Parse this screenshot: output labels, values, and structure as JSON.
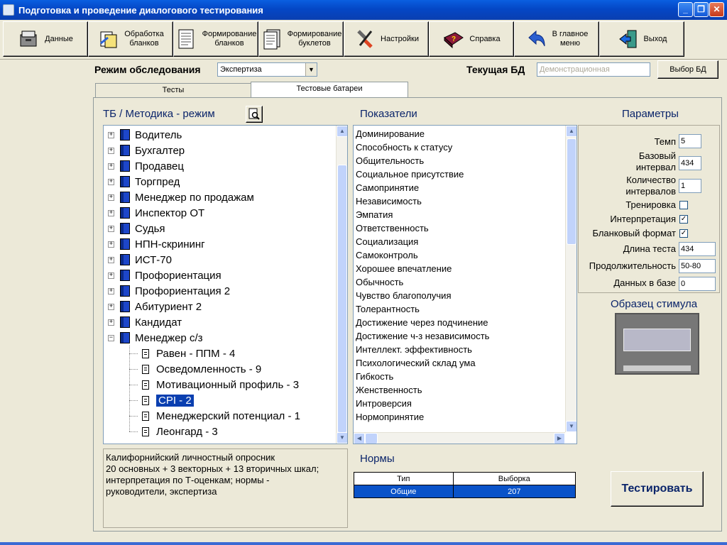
{
  "window": {
    "title": "Подготовка и проведение диалогового тестирования",
    "minimize": "_",
    "restore": "❐",
    "close": "✕"
  },
  "toolbar": {
    "buttons": [
      {
        "label": "Данные",
        "icon": "data-cabinet-icon"
      },
      {
        "label": "Обработка\nбланков",
        "icon": "process-forms-icon"
      },
      {
        "label": "Формирование\nбланков",
        "icon": "forms-icon"
      },
      {
        "label": "Формирование\nбуклетов",
        "icon": "booklets-icon"
      },
      {
        "label": "Настройки",
        "icon": "tools-icon"
      },
      {
        "label": "Справка",
        "icon": "help-book-icon"
      },
      {
        "label": "В главное\nменю",
        "icon": "back-arrow-icon"
      },
      {
        "label": "Выход",
        "icon": "exit-door-icon"
      }
    ]
  },
  "controls": {
    "mode_label": "Режим обследования",
    "mode_value": "Экспертиза",
    "db_label": "Текущая БД",
    "db_value": "Демонстрационная",
    "db_button": "Выбор БД"
  },
  "tabs": [
    "Тесты",
    "Тестовые батареи"
  ],
  "tree": {
    "title": "ТБ / Методика - режим",
    "items": [
      {
        "label": "Водитель",
        "type": "group",
        "expander": "+"
      },
      {
        "label": "Бухгалтер",
        "type": "group",
        "expander": "+"
      },
      {
        "label": "Продавец",
        "type": "group",
        "expander": "+"
      },
      {
        "label": "Торгпред",
        "type": "group",
        "expander": "+"
      },
      {
        "label": "Менеджер по продажам",
        "type": "group",
        "expander": "+"
      },
      {
        "label": "Инспектор ОТ",
        "type": "group",
        "expander": "+"
      },
      {
        "label": "Судья",
        "type": "group",
        "expander": "+"
      },
      {
        "label": "НПН-скрининг",
        "type": "group",
        "expander": "+"
      },
      {
        "label": "ИСТ-70",
        "type": "group",
        "expander": "+"
      },
      {
        "label": "Профориентация",
        "type": "group",
        "expander": "+"
      },
      {
        "label": "Профориентация 2",
        "type": "group",
        "expander": "+"
      },
      {
        "label": "Абитуриент 2",
        "type": "group",
        "expander": "+"
      },
      {
        "label": "Кандидат",
        "type": "group",
        "expander": "+"
      },
      {
        "label": "Менеджер с/з",
        "type": "group",
        "expander": "−"
      },
      {
        "label": "Равен - ППМ - 4",
        "type": "child"
      },
      {
        "label": "Осведомленность - 9",
        "type": "child"
      },
      {
        "label": "Мотивационный профиль - 3",
        "type": "child"
      },
      {
        "label": "CPI - 2",
        "type": "child",
        "selected": true
      },
      {
        "label": "Менеджерский потенциал - 1",
        "type": "child"
      },
      {
        "label": "Леонгард - 3",
        "type": "child"
      }
    ]
  },
  "description": "Калифорнийский личностный опросник\n20 основных + 3 векторных + 13 вторичных шкал;\nинтерпретация по Т-оценкам; нормы -\nруководители, экспертиза",
  "indicators": {
    "title": "Показатели",
    "items": [
      "Доминирование",
      "Способность к статусу",
      "Общительность",
      "Социальное присутствие",
      "Самопринятие",
      "Независимость",
      "Эмпатия",
      "Ответственность",
      "Социализация",
      "Самоконтроль",
      "Хорошее впечатление",
      "Обычность",
      "Чувство благополучия",
      "Толерантность",
      "Достижение через подчинение",
      "Достижение ч-з независимость",
      "Интеллект. эффективность",
      "Психологический склад ума",
      "Гибкость",
      "Женственность",
      "Интроверсия",
      "Нормопринятие"
    ]
  },
  "params": {
    "title": "Параметры",
    "tempo_label": "Темп",
    "tempo": "5",
    "base_interval_label": "Базовый\nинтервал",
    "base_interval": "434",
    "interval_count_label": "Количество\nинтервалов",
    "interval_count": "1",
    "training_label": "Тренировка",
    "training": false,
    "interpretation_label": "Интерпретация",
    "interpretation": true,
    "blank_format_label": "Бланковый формат",
    "blank_format": true,
    "test_length_label": "Длина теста",
    "test_length": "434",
    "duration_label": "Продолжительность",
    "duration": "50-80",
    "db_count_label": "Данных в базе",
    "db_count": "0",
    "stimulus_title": "Образец стимула"
  },
  "norms": {
    "title": "Нормы",
    "columns": [
      "Тип",
      "Выборка"
    ],
    "rows": [
      [
        "Общие",
        "207"
      ]
    ]
  },
  "start_button": "Тестировать"
}
